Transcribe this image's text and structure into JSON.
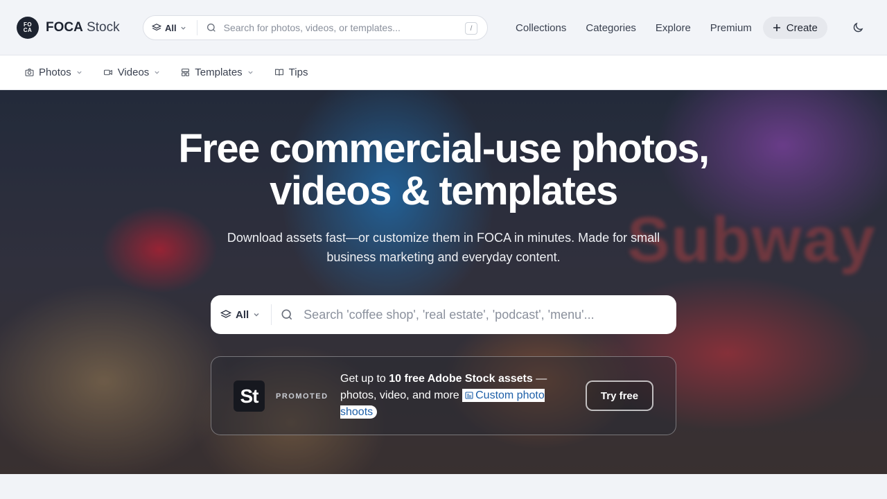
{
  "header": {
    "logo_mark_top": "FO",
    "logo_mark_bottom": "CA",
    "brand_bold": "FOCA",
    "brand_light": "Stock",
    "search": {
      "scope": "All",
      "placeholder": "Search for photos, videos, or templates...",
      "shortcut": "/"
    },
    "nav": [
      "Collections",
      "Categories",
      "Explore",
      "Premium"
    ],
    "create_label": "Create"
  },
  "subnav": {
    "photos": "Photos",
    "videos": "Videos",
    "templates": "Templates",
    "tips": "Tips"
  },
  "hero": {
    "title_line1": "Free commercial-use photos,",
    "title_line2": "videos & templates",
    "subtitle": "Download assets fast—or customize them in FOCA in minutes. Made for small business marketing and everyday content.",
    "background_sign_text": "Subway",
    "search": {
      "scope": "All",
      "placeholder": "Search 'coffee shop', 'real estate', 'podcast', 'menu'..."
    }
  },
  "promo": {
    "logo": "St",
    "tag": "PROMOTED",
    "text_prefix": "Get up to ",
    "text_bold": "10 free Adobe Stock assets",
    "text_suffix": " — photos, video, and more ",
    "link_label": "Custom photo shoots",
    "button_label": "Try free"
  },
  "colors": {
    "accent_dark": "#1d2330",
    "link_blue": "#1d5fa8",
    "page_bg": "#f1f3f7"
  },
  "icons": [
    "layers-icon",
    "search-icon",
    "chevron-down-icon",
    "plus-icon",
    "moon-icon",
    "camera-icon",
    "video-icon",
    "template-icon",
    "book-icon",
    "image-icon"
  ]
}
